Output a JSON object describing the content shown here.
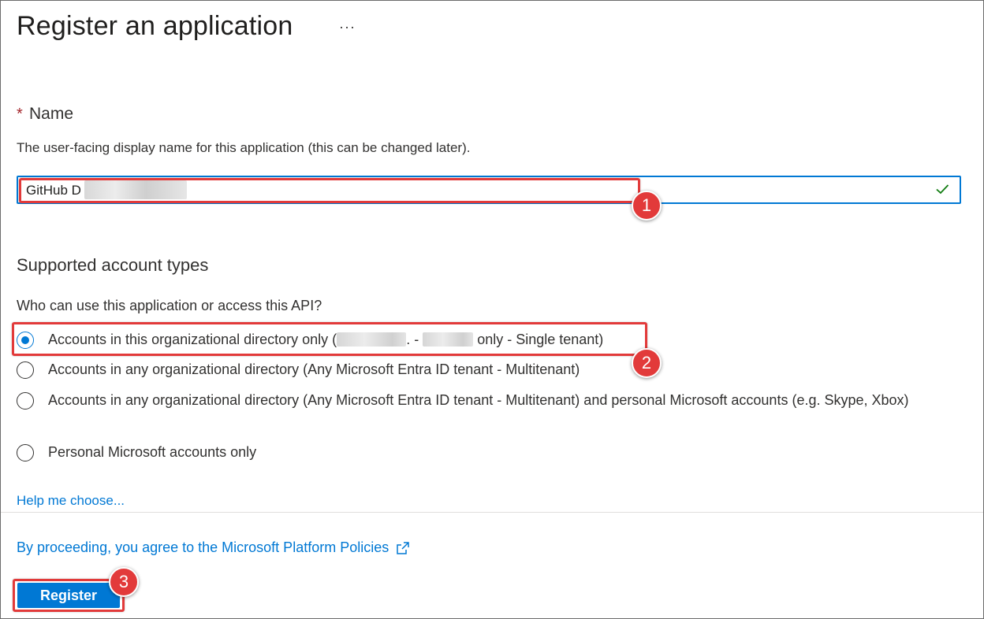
{
  "page": {
    "title": "Register an application",
    "more_icon": "more-ellipsis-icon",
    "more_glyph": "···"
  },
  "name_field": {
    "required_marker": "*",
    "label": "Name",
    "description": "The user-facing display name for this application (this can be changed later).",
    "value": "GitHub D",
    "valid_icon": "checkmark-icon"
  },
  "account_types": {
    "title": "Supported account types",
    "question": "Who can use this application or access this API?",
    "options": [
      {
        "prefix": "Accounts in this organizational directory only (",
        "middle": ". - ",
        "suffix": " only - Single tenant)",
        "selected": true
      },
      {
        "label": "Accounts in any organizational directory (Any Microsoft Entra ID tenant - Multitenant)",
        "selected": false
      },
      {
        "label": "Accounts in any organizational directory (Any Microsoft Entra ID tenant - Multitenant) and personal Microsoft accounts (e.g. Skype, Xbox)",
        "selected": false
      },
      {
        "label": "Personal Microsoft accounts only",
        "selected": false
      }
    ],
    "help_link": "Help me choose..."
  },
  "footer": {
    "policy_link": "By proceeding, you agree to the Microsoft Platform Policies",
    "policy_icon": "external-link-icon",
    "register_label": "Register"
  },
  "annotations": {
    "callout_1": "1",
    "callout_2": "2",
    "callout_3": "3",
    "highlight_color": "#e23a3a"
  },
  "colors": {
    "accent": "#0078d4",
    "required": "#a4262c",
    "text": "#323130",
    "valid": "#107c10"
  }
}
